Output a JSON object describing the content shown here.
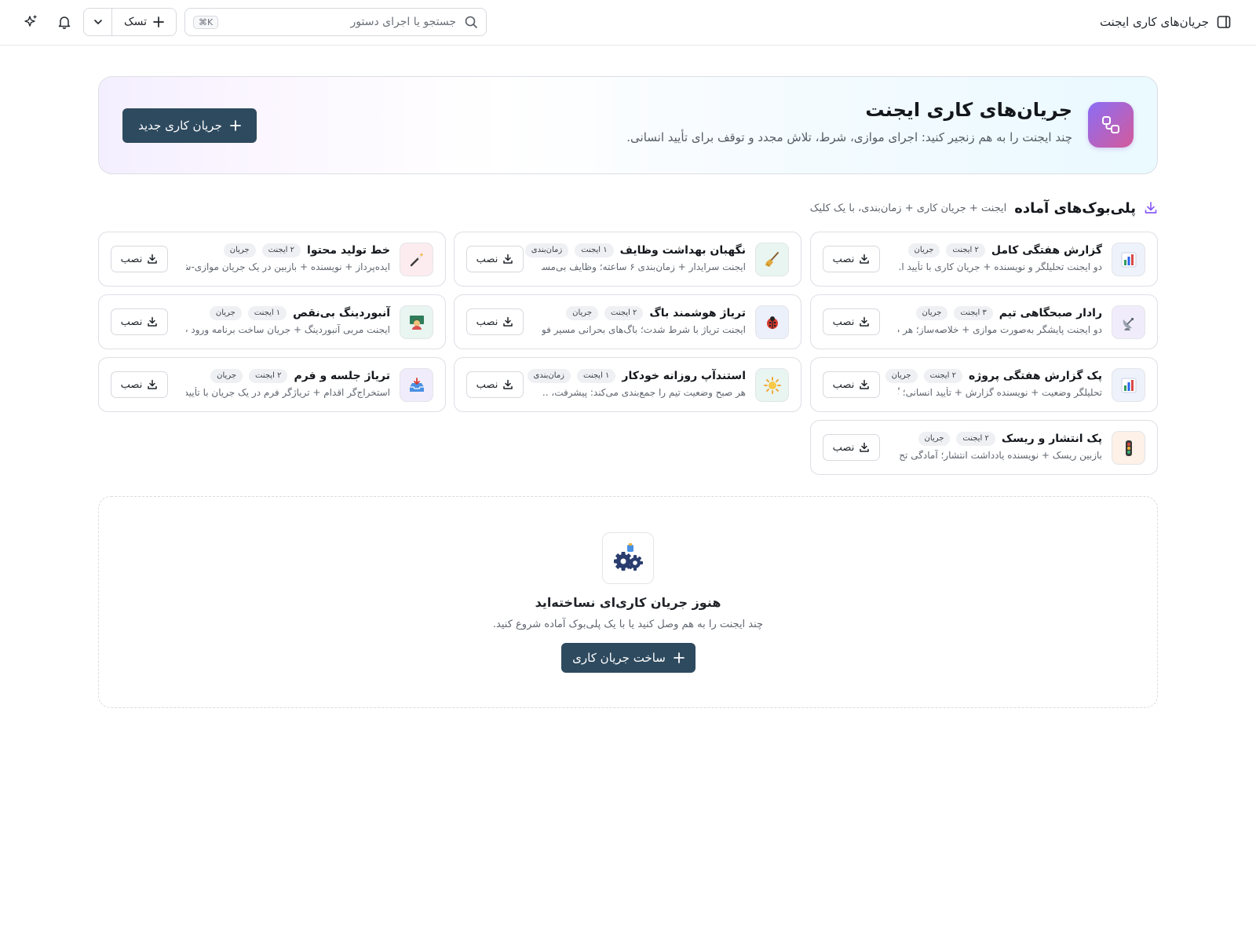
{
  "topbar": {
    "title": "جریان‌های کاری ایجنت",
    "search_placeholder": "جستجو یا اجرای دستور",
    "search_shortcut": "⌘K",
    "task_label": "تسک"
  },
  "hero": {
    "title": "جریان‌های کاری ایجنت",
    "subtitle": "چند ایجنت را به هم زنجیر کنید: اجرای موازی، شرط، تلاش مجدد و توقف برای تأیید انسانی.",
    "new_button": "جریان کاری جدید"
  },
  "playbooks": {
    "title": "پلی‌بوک‌های آماده",
    "subtitle": "ایجنت + جریان کاری + زمان‌بندی، با یک کلیک",
    "install_label": "نصب",
    "items": [
      {
        "title": "گزارش هفتگی کامل",
        "badges": [
          "۲ ایجنت",
          "جریان"
        ],
        "desc": "دو ایجنت تحلیلگر و نویسنده + جریان کاری با تأیید ا...",
        "icon": "bar-chart-icon",
        "icon_bg": "#eef2fb"
      },
      {
        "title": "نگهبان بهداشت وظایف",
        "badges": [
          "۱ ایجنت",
          "زمان‌بندی"
        ],
        "desc": "ایجنت سرایدار + زمان‌بندی ۶ ساعته؛ وظایف بی‌مسئ...",
        "icon": "broom-icon",
        "icon_bg": "#e8f5f1"
      },
      {
        "title": "خط تولید محتوا",
        "badges": [
          "۲ ایجنت",
          "جریان"
        ],
        "desc": "ایده‌پرداز + نویسنده + بازبین در یک جریان موازی-ش...",
        "icon": "magic-wand-icon",
        "icon_bg": "#fdecef"
      },
      {
        "title": "رادار صبحگاهی تیم",
        "badges": [
          "۳ ایجنت",
          "جریان"
        ],
        "desc": "دو ایجنت پایشگر به‌صورت موازی + خلاصه‌ساز؛ هر ص...",
        "icon": "satellite-dish-icon",
        "icon_bg": "#f1ecfb"
      },
      {
        "title": "تریاژ هوشمند باگ",
        "badges": [
          "۲ ایجنت",
          "جریان"
        ],
        "desc": "ایجنت تریاژ با شرط شدت؛ باگ‌های بحرانی مسیر فور...",
        "icon": "ladybug-icon",
        "icon_bg": "#ecf0fb"
      },
      {
        "title": "آنبوردینگ بی‌نقص",
        "badges": [
          "۱ ایجنت",
          "جریان"
        ],
        "desc": "ایجنت مربی آنبوردینگ + جریان ساخت برنامه ورود ب...",
        "icon": "teacher-icon",
        "icon_bg": "#e8f5f1"
      },
      {
        "title": "پک گزارش هفتگی پروژه",
        "badges": [
          "۲ ایجنت",
          "جریان"
        ],
        "desc": "تحلیلگر وضعیت + نویسنده گزارش + تأیید انسانی؛ گ...",
        "icon": "bar-chart-icon",
        "icon_bg": "#eef2fb"
      },
      {
        "title": "استندآپ روزانه خودکار",
        "badges": [
          "۱ ایجنت",
          "زمان‌بندی"
        ],
        "desc": "هر صبح وضعیت تیم را جمع‌بندی می‌کند: پیشرفت، ...",
        "icon": "sun-icon",
        "icon_bg": "#e8f5f1"
      },
      {
        "title": "تریاژ جلسه و فرم",
        "badges": [
          "۲ ایجنت",
          "جریان"
        ],
        "desc": "استخراج‌گر اقدام + تریاژگر فرم در یک جریان با تأیید؛ ...",
        "icon": "inbox-tray-icon",
        "icon_bg": "#f1ecfb"
      },
      {
        "title": "پک انتشار و ریسک",
        "badges": [
          "۲ ایجنت",
          "جریان"
        ],
        "desc": "بازبین ریسک + نویسنده یادداشت انتشار؛ آمادگی تح...",
        "icon": "traffic-light-icon",
        "icon_bg": "#fdf1e8"
      }
    ]
  },
  "empty_state": {
    "title": "هنوز جریان کاری‌ای نساخته‌اید",
    "subtitle": "چند ایجنت را به هم وصل کنید یا با یک پلی‌بوک آماده شروع کنید.",
    "button": "ساخت جریان کاری"
  },
  "colors": {
    "primary_button": "#2e4a5f",
    "accent_purple": "#8b6df5",
    "accent_pink": "#d45a9a"
  }
}
